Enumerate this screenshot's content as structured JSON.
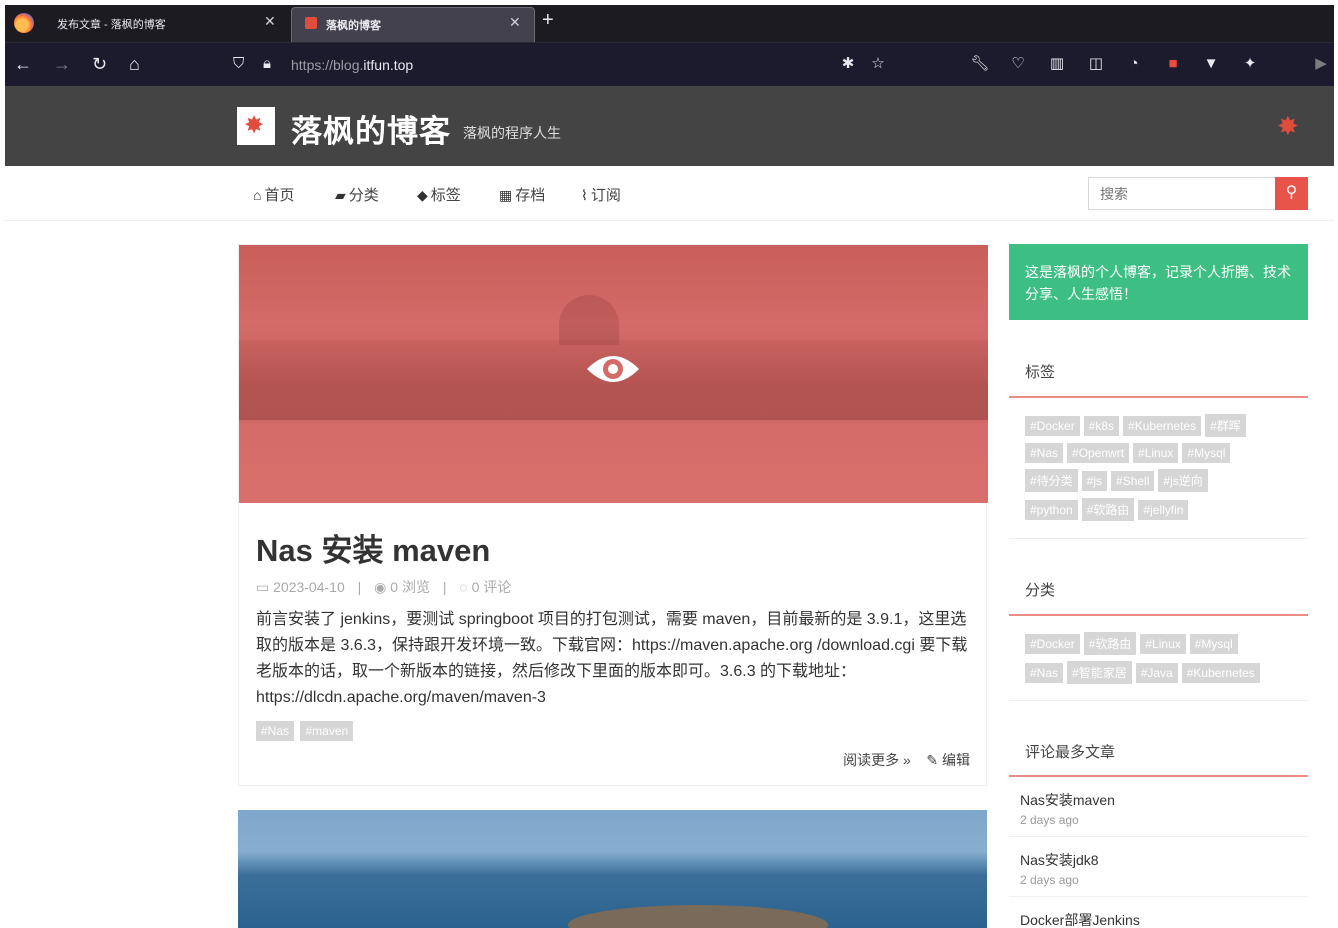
{
  "browser": {
    "tabs": [
      {
        "title": "发布文章 - 落枫的博客",
        "active": false
      },
      {
        "title": "落枫的博客",
        "active": true
      }
    ],
    "new_tab": "+",
    "url_prefix": "https://blog.",
    "url_domain": "itfun.top"
  },
  "site": {
    "title": "落枫的博客",
    "tagline": "落枫的程序人生",
    "accent": "#e8534a"
  },
  "menu": {
    "items": [
      "首页",
      "分类",
      "标签",
      "存档",
      "订阅"
    ],
    "search_placeholder": "搜索"
  },
  "post": {
    "title": "Nas 安装 maven",
    "date": "2023-04-10",
    "views": "0 浏览",
    "comments": "0 评论",
    "excerpt": "前言安装了 jenkins，要测试 springboot 项目的打包测试，需要 maven，目前最新的是 3.9.1，这里选取的版本是 3.6.3，保持跟开发环境一致。下载官网：https://maven.apache.org /download.cgi 要下载老版本的话，取一个新版本的链接，然后修改下里面的版本即可。3.6.3 的下载地址：https://dlcdn.apache.org/maven/maven-3",
    "tags": [
      "#Nas",
      "#maven"
    ],
    "read_more": "阅读更多 »",
    "edit": "编辑"
  },
  "sidebar": {
    "intro": "这是落枫的个人博客，记录个人折腾、技术分享、人生感悟！",
    "tags_title": "标签",
    "tags": [
      "#Docker",
      "#k8s",
      "#Kubernetes",
      "#群晖",
      "#Nas",
      "#Openwrt",
      "#Linux",
      "#Mysql",
      "#待分类",
      "#js",
      "#Shell",
      "#js逆向",
      "#python",
      "#软路由",
      "#jellyfin"
    ],
    "categories_title": "分类",
    "categories": [
      "#Docker",
      "#软路由",
      "#Linux",
      "#Mysql",
      "#Nas",
      "#智能家居",
      "#Java",
      "#Kubernetes"
    ],
    "hot_title": "评论最多文章",
    "hot_posts": [
      {
        "title": "Nas安装maven",
        "time": "2 days ago"
      },
      {
        "title": "Nas安装jdk8",
        "time": "2 days ago"
      },
      {
        "title": "Docker部署Jenkins",
        "time": ""
      }
    ]
  }
}
